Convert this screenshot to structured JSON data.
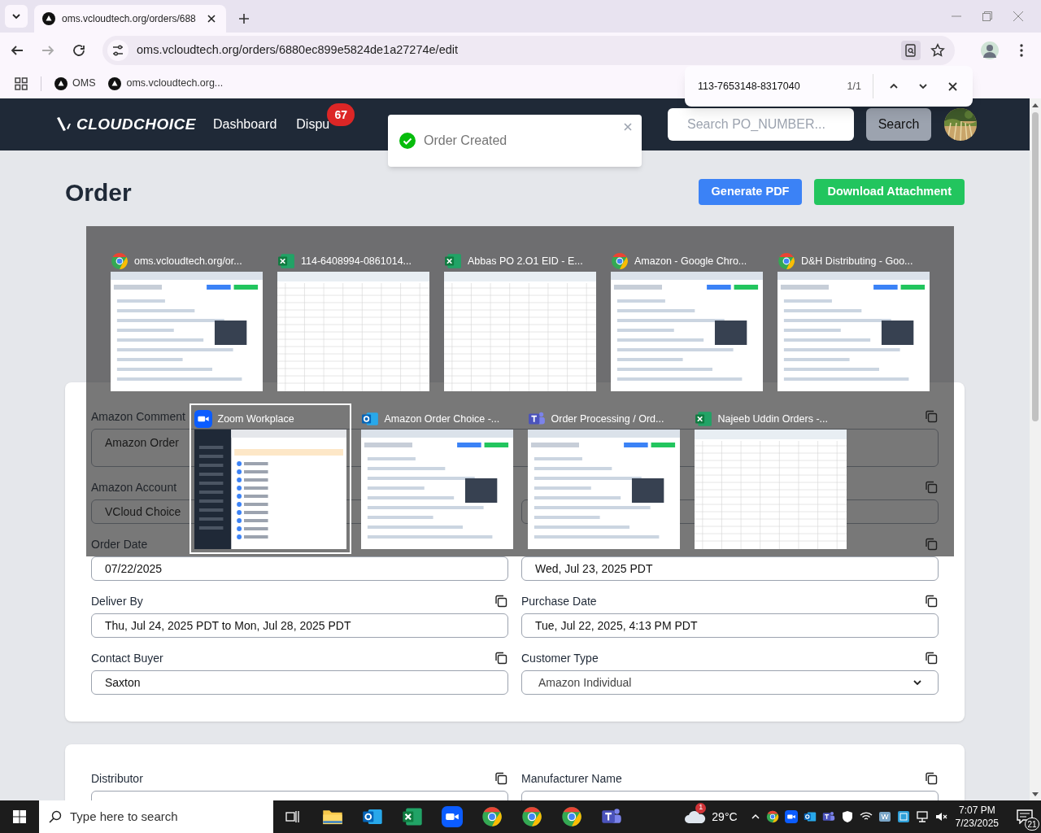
{
  "browser": {
    "tab_title": "oms.vcloudtech.org/orders/688",
    "url": "oms.vcloudtech.org/orders/6880ec899e5824de1a27274e/edit",
    "bookmarks": [
      "OMS",
      "oms.vcloudtech.org..."
    ],
    "find_bar": {
      "query": "113-7653148-8317040",
      "count": "1/1"
    }
  },
  "header": {
    "logo": "CLOUDCHOICE",
    "nav": [
      {
        "label": "Dashboard"
      },
      {
        "label": "Dispu",
        "badge": "67"
      }
    ],
    "search": {
      "placeholder": "Search PO_NUMBER...",
      "button": "Search"
    }
  },
  "toast": {
    "message": "Order Created"
  },
  "page": {
    "title": "Order",
    "buttons": [
      {
        "label": "Generate PDF",
        "kind": "primary"
      },
      {
        "label": "Download Attachment",
        "kind": "success"
      }
    ]
  },
  "form": {
    "fields": [
      {
        "label": "Amazon Comment",
        "value": "Amazon Order",
        "kind": "textarea"
      },
      {
        "label": "Amazon Account",
        "value": "VCloud Choice",
        "kind": "input",
        "copy": false
      },
      {
        "kind": "input"
      },
      {
        "label": "Order Date",
        "value": "07/22/2025",
        "kind": "input",
        "copy": false
      },
      {
        "value": "Wed, Jul 23, 2025 PDT",
        "kind": "input"
      },
      {
        "label": "Deliver By",
        "value": "Thu, Jul 24, 2025 PDT to Mon, Jul 28, 2025 PDT",
        "kind": "input"
      },
      {
        "label": "Purchase Date",
        "value": "Tue, Jul 22, 2025, 4:13 PM PDT",
        "kind": "input"
      },
      {
        "label": "Contact Buyer",
        "value": "Saxton",
        "kind": "input"
      },
      {
        "label": "Customer Type",
        "value": "Amazon Individual",
        "kind": "select"
      }
    ]
  },
  "lower_form": {
    "fields": [
      {
        "label": "Distributor"
      },
      {
        "label": "Manufacturer Name"
      }
    ]
  },
  "task_switcher": {
    "windows": [
      {
        "title": "oms.vcloudtech.org/or...",
        "kind": "chrome",
        "selected": false
      },
      {
        "title": "114-6408994-0861014...",
        "kind": "excel",
        "selected": false
      },
      {
        "title": "Abbas PO 2.O1  EID - E...",
        "kind": "excel",
        "selected": false
      },
      {
        "title": "Amazon - Google Chro...",
        "kind": "chrome",
        "selected": false
      },
      {
        "title": "D&H Distributing - Goo...",
        "kind": "chrome",
        "selected": false
      },
      {
        "title": "Zoom Workplace",
        "kind": "zoom",
        "selected": true
      },
      {
        "title": "Amazon Order Choice -...",
        "kind": "outlook",
        "selected": false
      },
      {
        "title": "Order Processing / Ord...",
        "kind": "teams",
        "selected": false
      },
      {
        "title": "Najeeb Uddin Orders -...",
        "kind": "excel",
        "selected": false
      }
    ]
  },
  "taskbar": {
    "search_placeholder": "Type here to search",
    "apps": [
      {
        "kind": "explorer"
      },
      {
        "kind": "outlook"
      },
      {
        "kind": "excel"
      },
      {
        "kind": "zoom"
      },
      {
        "kind": "chrome"
      },
      {
        "kind": "chrome"
      },
      {
        "kind": "chrome"
      },
      {
        "kind": "teams"
      }
    ],
    "weather": {
      "temp": "29°C",
      "badge": "1"
    },
    "time": "7:07 PM",
    "date": "7/23/2025",
    "notifications": "21"
  }
}
